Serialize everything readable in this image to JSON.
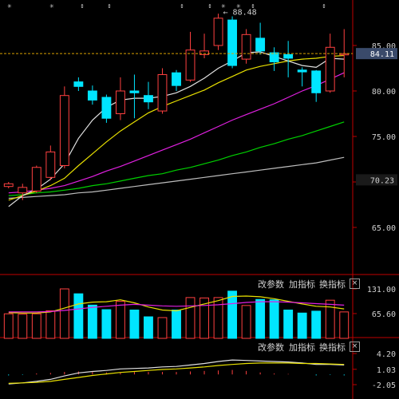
{
  "colors": {
    "up": "#ff4040",
    "down": "#00e5ff",
    "ma5": "#e0e0e0",
    "ma10": "#e8e000",
    "ma20": "#e020e0",
    "ma60": "#00d000",
    "ma120": "#bdbdbd",
    "axis": "#c00000",
    "text": "#cfcfcf",
    "last_price_line": "#d8a000",
    "last_price_box": "#3a4a6a"
  },
  "markers": [
    "star",
    "star",
    "arrow",
    "arrow",
    "arrow",
    "arrow",
    "star",
    "star",
    "arrow",
    "arrow",
    "star"
  ],
  "main_panel": {
    "y_ticks": [
      "85.00",
      "80.00",
      "75.00",
      "70.00",
      "65.00"
    ],
    "last_price_label": "84.11",
    "extra_price_label": "70.23",
    "high_annotation": "88.48"
  },
  "volume_panel": {
    "buttons": [
      "改参数",
      "加指标",
      "换指标"
    ],
    "close_icon": "×",
    "y_ticks": [
      "131.00",
      "65.60"
    ]
  },
  "indicator_panel": {
    "buttons": [
      "改参数",
      "加指标",
      "换指标"
    ],
    "close_icon": "×",
    "y_ticks": [
      "4.20",
      "1.03",
      "-2.05"
    ]
  },
  "chart_data": [
    {
      "type": "candlestick",
      "ylim": [
        65,
        90
      ],
      "y_ticks": [
        85,
        80,
        75,
        70,
        65
      ],
      "last_price": 84.11,
      "high_annotation": 88.48,
      "candles": [
        {
          "o": 69.5,
          "h": 70.0,
          "l": 69.3,
          "c": 69.8
        },
        {
          "o": 68.8,
          "h": 69.8,
          "l": 68.0,
          "c": 69.4
        },
        {
          "o": 69.0,
          "h": 71.8,
          "l": 68.8,
          "c": 71.6
        },
        {
          "o": 70.5,
          "h": 74.0,
          "l": 70.2,
          "c": 73.3
        },
        {
          "o": 71.8,
          "h": 80.5,
          "l": 71.5,
          "c": 79.5
        },
        {
          "o": 81.0,
          "h": 81.5,
          "l": 80.0,
          "c": 80.5
        },
        {
          "o": 80.0,
          "h": 80.6,
          "l": 78.5,
          "c": 79.0
        },
        {
          "o": 79.3,
          "h": 79.6,
          "l": 76.5,
          "c": 77.0
        },
        {
          "o": 77.5,
          "h": 81.5,
          "l": 76.8,
          "c": 80.0
        },
        {
          "o": 80.0,
          "h": 81.8,
          "l": 77.0,
          "c": 79.8
        },
        {
          "o": 79.5,
          "h": 81.0,
          "l": 78.0,
          "c": 78.8
        },
        {
          "o": 77.8,
          "h": 82.5,
          "l": 77.5,
          "c": 81.8
        },
        {
          "o": 82.0,
          "h": 82.3,
          "l": 80.0,
          "c": 80.6
        },
        {
          "o": 81.2,
          "h": 86.5,
          "l": 81.0,
          "c": 84.5
        },
        {
          "o": 84.0,
          "h": 86.3,
          "l": 83.6,
          "c": 84.4
        },
        {
          "o": 85.0,
          "h": 88.5,
          "l": 84.5,
          "c": 88.0
        },
        {
          "o": 87.8,
          "h": 88.2,
          "l": 82.5,
          "c": 82.8
        },
        {
          "o": 83.5,
          "h": 86.8,
          "l": 83.0,
          "c": 86.2
        },
        {
          "o": 85.8,
          "h": 87.5,
          "l": 84.0,
          "c": 84.4
        },
        {
          "o": 84.2,
          "h": 84.8,
          "l": 82.2,
          "c": 83.2
        },
        {
          "o": 84.0,
          "h": 85.5,
          "l": 81.5,
          "c": 83.6
        },
        {
          "o": 82.3,
          "h": 82.6,
          "l": 80.5,
          "c": 82.1
        },
        {
          "o": 82.2,
          "h": 82.3,
          "l": 78.8,
          "c": 79.8
        },
        {
          "o": 80.0,
          "h": 86.3,
          "l": 79.8,
          "c": 84.8
        },
        {
          "o": 84.1,
          "h": 86.8,
          "l": 81.5,
          "c": 84.1
        }
      ],
      "ma5": [
        67.3,
        68.5,
        69.2,
        70.3,
        72.0,
        74.8,
        76.8,
        78.2,
        79.0,
        79.2,
        79.2,
        79.4,
        79.8,
        80.5,
        81.4,
        82.5,
        83.3,
        84.2,
        84.3,
        83.8,
        83.3,
        82.8,
        82.6,
        83.6,
        83.5
      ],
      "ma10": [
        68.0,
        68.5,
        69.0,
        69.6,
        70.4,
        71.8,
        73.1,
        74.4,
        75.6,
        76.6,
        77.6,
        78.3,
        78.9,
        79.5,
        80.1,
        80.9,
        81.6,
        82.3,
        82.7,
        83.0,
        83.3,
        83.5,
        83.6,
        83.8,
        83.9
      ],
      "ma20": [
        68.8,
        68.9,
        69.1,
        69.3,
        69.6,
        70.1,
        70.6,
        71.2,
        71.7,
        72.3,
        72.9,
        73.5,
        74.1,
        74.7,
        75.4,
        76.1,
        76.8,
        77.4,
        78.0,
        78.6,
        79.3,
        80.0,
        80.6,
        81.3,
        82.0
      ],
      "ma60": [
        68.5,
        68.6,
        68.8,
        68.9,
        69.1,
        69.3,
        69.6,
        69.8,
        70.1,
        70.4,
        70.7,
        70.9,
        71.3,
        71.6,
        72.0,
        72.4,
        72.9,
        73.3,
        73.8,
        74.2,
        74.7,
        75.1,
        75.6,
        76.1,
        76.6
      ],
      "ma120": [
        68.2,
        68.3,
        68.4,
        68.5,
        68.6,
        68.8,
        68.9,
        69.1,
        69.3,
        69.5,
        69.7,
        69.9,
        70.1,
        70.3,
        70.5,
        70.7,
        70.9,
        71.1,
        71.3,
        71.5,
        71.7,
        71.9,
        72.1,
        72.4,
        72.7
      ]
    },
    {
      "type": "bar",
      "name": "volume",
      "ylim": [
        0,
        131
      ],
      "y_ticks": [
        131,
        65.6
      ],
      "values": [
        65,
        64,
        65,
        73,
        131,
        118,
        88,
        76,
        98,
        75,
        57,
        55,
        75,
        108,
        107,
        108,
        125,
        87,
        103,
        102,
        75,
        67,
        72,
        101,
        70
      ],
      "ma_a": [
        68,
        67,
        67,
        70,
        80,
        91,
        96,
        97,
        102,
        94,
        83,
        75,
        73,
        82,
        91,
        100,
        111,
        112,
        110,
        105,
        98,
        91,
        85,
        83,
        78
      ],
      "ma_b": [
        70,
        70,
        70,
        71,
        74,
        78,
        82,
        85,
        88,
        90,
        88,
        86,
        85,
        86,
        87,
        89,
        92,
        95,
        97,
        97,
        96,
        94,
        92,
        90,
        88
      ]
    },
    {
      "type": "line",
      "name": "indicator",
      "ylim": [
        -2.05,
        4.2
      ],
      "y_ticks": [
        4.2,
        1.03,
        -2.05
      ],
      "line_a": [
        -1.9,
        -1.7,
        -1.4,
        -1.0,
        -0.3,
        0.3,
        0.6,
        0.8,
        1.1,
        1.2,
        1.3,
        1.5,
        1.6,
        1.9,
        2.2,
        2.6,
        2.9,
        2.8,
        2.7,
        2.6,
        2.5,
        2.3,
        2.0,
        2.0,
        1.9
      ],
      "line_b": [
        -1.8,
        -1.7,
        -1.6,
        -1.4,
        -1.0,
        -0.6,
        -0.2,
        0.1,
        0.4,
        0.6,
        0.8,
        1.0,
        1.1,
        1.3,
        1.5,
        1.8,
        2.0,
        2.2,
        2.3,
        2.3,
        2.3,
        2.2,
        2.2,
        2.1,
        2.0
      ],
      "hist": [
        -0.2,
        -0.1,
        0.2,
        0.3,
        0.5,
        0.6,
        0.5,
        0.4,
        0.4,
        0.5,
        0.5,
        0.5,
        0.5,
        0.6,
        0.7,
        0.8,
        0.9,
        0.7,
        0.4,
        0.2,
        0.1,
        0.0,
        -0.2,
        -0.1,
        -0.2
      ]
    }
  ]
}
